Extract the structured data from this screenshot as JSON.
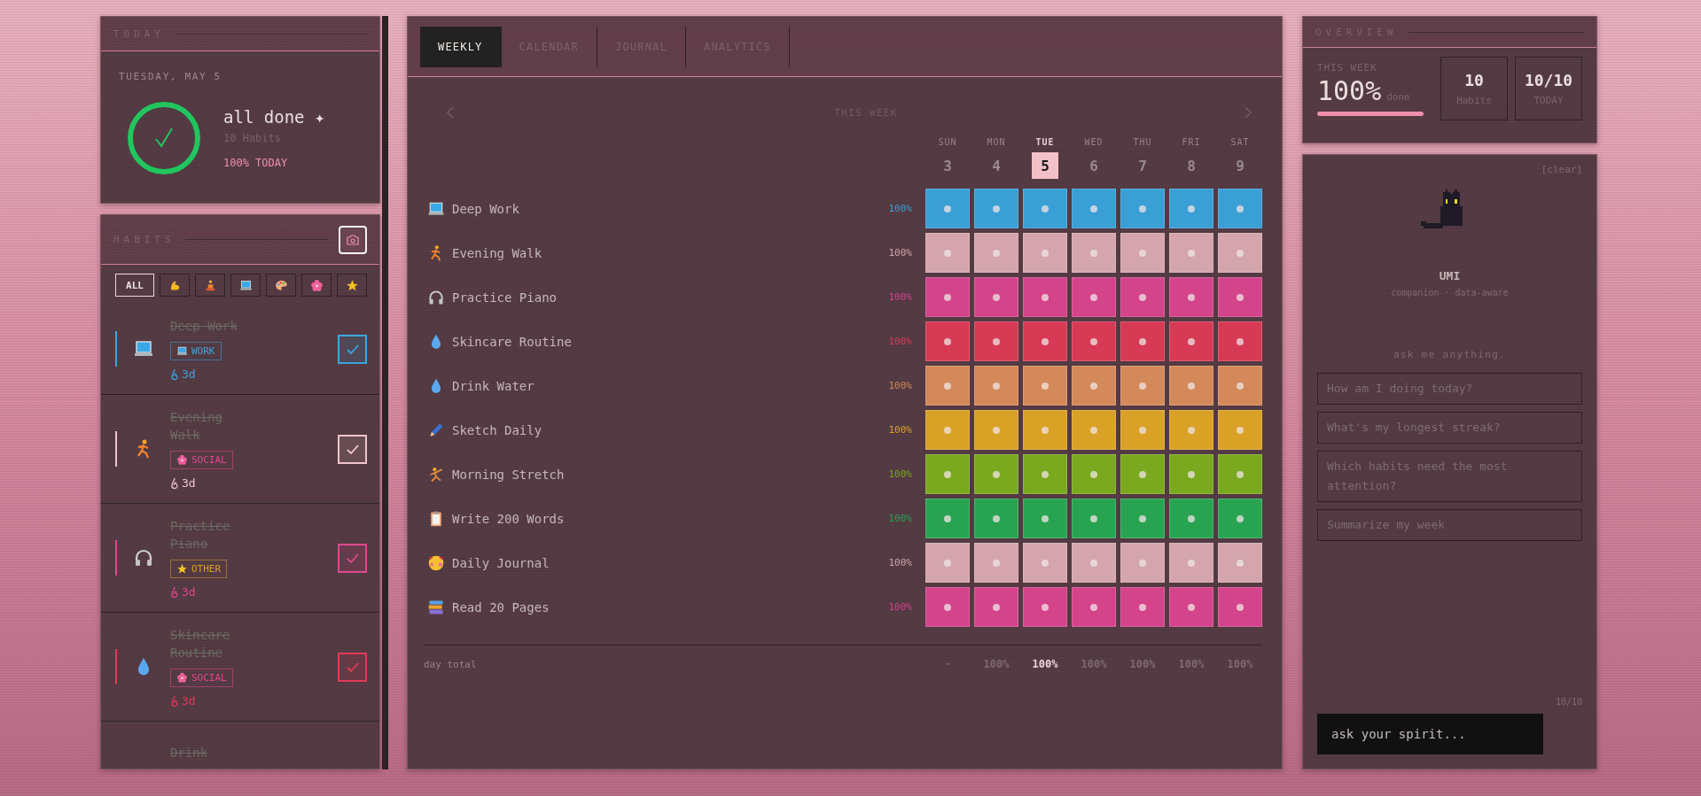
{
  "sidebar": {
    "today": {
      "title": "TODAY",
      "date": "TUESDAY, MAY 5",
      "level": 1,
      "status": "all done ✦",
      "count": "10 Habits",
      "summary": "100% TODAY"
    },
    "habits": {
      "title": "HABITS",
      "filters": [
        {
          "kind": "text",
          "label": "ALL",
          "selected": true
        },
        {
          "kind": "muscle",
          "selected": false
        },
        {
          "kind": "meditate",
          "selected": false
        },
        {
          "kind": "laptop",
          "selected": false
        },
        {
          "kind": "palette",
          "selected": false
        },
        {
          "kind": "flower",
          "selected": false
        },
        {
          "kind": "star",
          "selected": false
        }
      ],
      "items": [
        {
          "kind": "laptop",
          "name": "Deep Work",
          "color": "#38a8e0",
          "tag": {
            "kind": "laptop",
            "label": "WORK",
            "color": "#38a8e0"
          },
          "streak": "3d",
          "done": true
        },
        {
          "kind": "runner",
          "name": "Evening Walk",
          "color": "#f0c4cc",
          "tag": {
            "kind": "flower",
            "label": "SOCIAL",
            "color": "#e0488e"
          },
          "streak": "3d",
          "done": true
        },
        {
          "kind": "headphones",
          "name": "Practice Piano",
          "color": "#e0488e",
          "tag": {
            "kind": "star",
            "label": "OTHER",
            "color": "#d9a126"
          },
          "streak": "3d",
          "done": true
        },
        {
          "kind": "droplet",
          "name": "Skincare Routine",
          "color": "#e03a58",
          "tag": {
            "kind": "flower",
            "label": "SOCIAL",
            "color": "#e0488e"
          },
          "streak": "3d",
          "done": true
        },
        {
          "name": "Drink",
          "done": true
        }
      ]
    }
  },
  "main": {
    "tabs": [
      {
        "label": "WEEKLY",
        "selected": true
      },
      {
        "label": "CALENDAR",
        "selected": false
      },
      {
        "label": "JOURNAL",
        "selected": false
      },
      {
        "label": "ANALYTICS",
        "selected": false
      }
    ],
    "week_title": "THIS WEEK",
    "days": [
      {
        "weekday": "SUN",
        "date": "3",
        "selected": false
      },
      {
        "weekday": "MON",
        "date": "4",
        "selected": false
      },
      {
        "weekday": "TUE",
        "date": "5",
        "selected": true
      },
      {
        "weekday": "WED",
        "date": "6",
        "selected": false
      },
      {
        "weekday": "THU",
        "date": "7",
        "selected": false
      },
      {
        "weekday": "FRI",
        "date": "8",
        "selected": false
      },
      {
        "weekday": "SAT",
        "date": "9",
        "selected": false
      }
    ],
    "rows": [
      {
        "kind": "laptop",
        "name": "Deep Work",
        "percent": "100%",
        "color": "#3a9fd4",
        "done": [
          true,
          true,
          true,
          true,
          true,
          true,
          true
        ]
      },
      {
        "kind": "runner",
        "name": "Evening Walk",
        "percent": "100%",
        "color": "#d4a5ad",
        "done": [
          true,
          true,
          true,
          true,
          true,
          true,
          true
        ]
      },
      {
        "kind": "headphones",
        "name": "Practice Piano",
        "percent": "100%",
        "color": "#d4448a",
        "done": [
          true,
          true,
          true,
          true,
          true,
          true,
          true
        ]
      },
      {
        "kind": "droplet",
        "name": "Skincare Routine",
        "percent": "100%",
        "color": "#d63a55",
        "done": [
          true,
          true,
          true,
          true,
          true,
          true,
          true
        ]
      },
      {
        "kind": "droplet",
        "name": "Drink Water",
        "percent": "100%",
        "color": "#d4895a",
        "done": [
          true,
          true,
          true,
          true,
          true,
          true,
          true
        ]
      },
      {
        "kind": "pen",
        "name": "Sketch Daily",
        "percent": "100%",
        "color": "#d9a126",
        "done": [
          true,
          true,
          true,
          true,
          true,
          true,
          true
        ]
      },
      {
        "kind": "stretch",
        "name": "Morning Stretch",
        "percent": "100%",
        "color": "#7aa81e",
        "done": [
          true,
          true,
          true,
          true,
          true,
          true,
          true
        ]
      },
      {
        "kind": "clipboard",
        "name": "Write 200 Words",
        "percent": "100%",
        "color": "#28a352",
        "done": [
          true,
          true,
          true,
          true,
          true,
          true,
          true
        ]
      },
      {
        "kind": "face",
        "name": "Daily Journal",
        "percent": "100%",
        "color": "#d4a5ad",
        "done": [
          true,
          true,
          true,
          true,
          true,
          true,
          true
        ]
      },
      {
        "kind": "books",
        "name": "Read 20 Pages",
        "percent": "100%",
        "color": "#d4448a",
        "done": [
          true,
          true,
          true,
          true,
          true,
          true,
          true
        ]
      }
    ],
    "footer": {
      "label": "day total",
      "totals": [
        {
          "value": "·",
          "selected": false
        },
        {
          "value": "100%",
          "selected": false
        },
        {
          "value": "100%",
          "selected": true
        },
        {
          "value": "100%",
          "selected": false
        },
        {
          "value": "100%",
          "selected": false
        },
        {
          "value": "100%",
          "selected": false
        },
        {
          "value": "100%",
          "selected": false
        }
      ]
    }
  },
  "overview": {
    "title": "OVERVIEW",
    "week_label": "THIS WEEK",
    "week_value": "100%",
    "week_suffix": "done",
    "level": 1,
    "stats": [
      {
        "value": "10",
        "label": "Habits"
      },
      {
        "value": "10/10",
        "label": "TODAY"
      }
    ]
  },
  "companion": {
    "clear": "[clear]",
    "name": "UMI",
    "subtitle": "companion · data-aware",
    "prompt": "ask me anything.",
    "suggestions": [
      "How am I doing today?",
      "What's my longest streak?",
      "Which habits need the most attention?",
      "Summarize my week"
    ],
    "counter": "10/10",
    "input": {
      "placeholder": "ask your spirit..."
    }
  }
}
